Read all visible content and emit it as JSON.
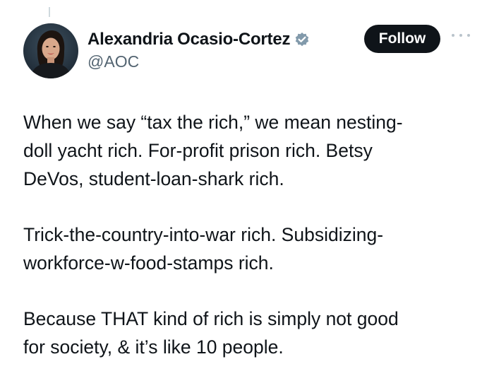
{
  "author": {
    "display_name": "Alexandria Ocasio-Cortez",
    "handle": "@AOC",
    "verified": true,
    "verified_color": "#829aab",
    "avatar_icon": "profile-photo"
  },
  "actions": {
    "follow_label": "Follow",
    "more_icon": "more-horizontal-icon"
  },
  "tweet": {
    "lines": [
      "When we say “tax the rich,” we mean nesting-",
      "doll yacht rich. For-profit prison rich. Betsy",
      "DeVos, student-loan-shark rich.",
      "Trick-the-country-into-war rich. Subsidizing-",
      "workforce-w-food-stamps rich.",
      "Because THAT kind of rich is simply not good",
      "for society, & it’s like 10 people."
    ]
  },
  "colors": {
    "text": "#0f1419",
    "secondary_text": "#536471",
    "follow_bg": "#0f1419",
    "follow_text": "#ffffff"
  }
}
